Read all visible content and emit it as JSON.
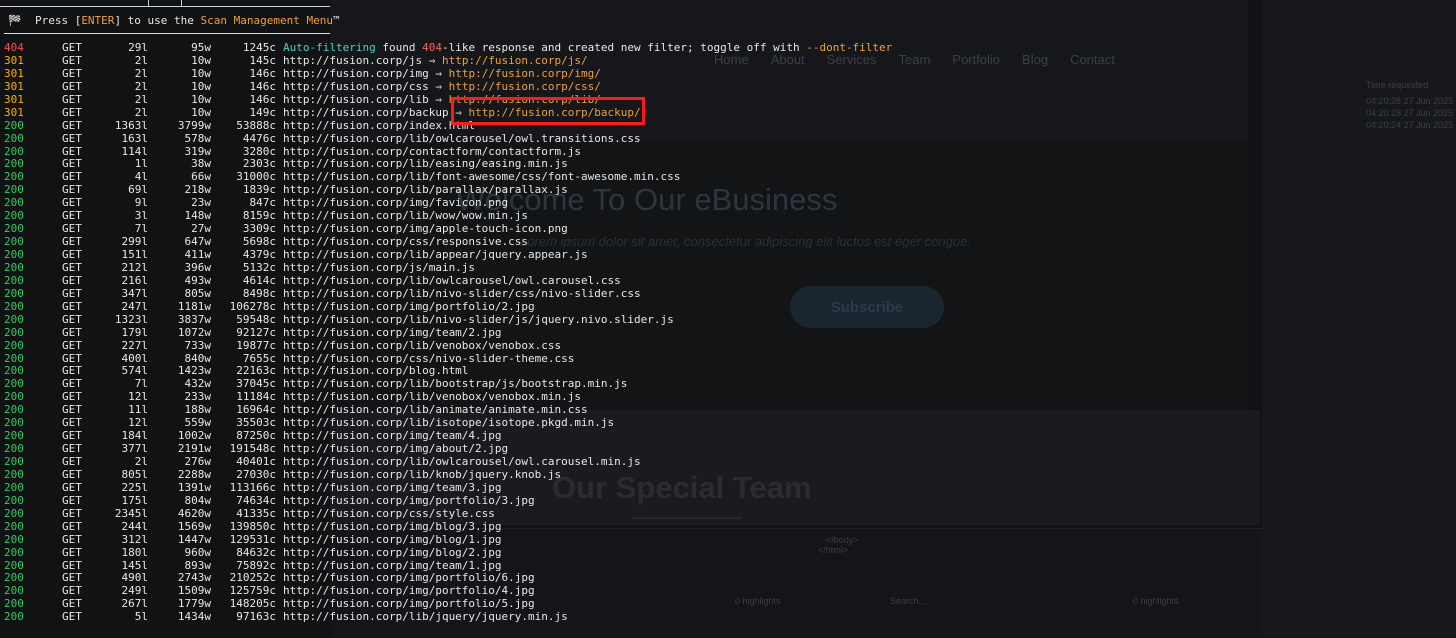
{
  "background": {
    "nav": [
      "Home",
      "About",
      "Services",
      "Team",
      "Portfolio",
      "Blog",
      "Contact"
    ],
    "hero_title": "Welcome To Our eBusiness",
    "hero_subtitle": "Lorem ipsum dolor sit amet, consectetur adipiscing elit luctus est eger congue.",
    "subscribe_label": "Subscribe",
    "team_heading": "Our Special Team",
    "right_panel": {
      "time_header": "Time requested",
      "timestamps": [
        "04:20:28 27 Jun 2025",
        "04:20:28 27 Jun 2025",
        "04:20:24 27 Jun 2025"
      ]
    },
    "devtools": {
      "highlights_left": "0 highlights",
      "highlights_right": "0 highlights",
      "code_lines": [
        "</body>",
        "</html>"
      ],
      "search_placeholder": "Search..."
    }
  },
  "terminal": {
    "press_prefix": "Press [",
    "press_key": "ENTER",
    "press_middle": "] to use the ",
    "press_menu": "Scan Management Menu",
    "press_suffix": "™",
    "flag_icon": "🏁",
    "rows": [
      {
        "status": "404",
        "method": "GET",
        "lines": "29l",
        "words": "95w",
        "chars": "1245c",
        "kind": "auto",
        "url": "",
        "auto_prefix": "Auto-filtering",
        "auto_mid": " found ",
        "auto_404": "404",
        "auto_rest": "-like response and created new filter; toggle off with ",
        "auto_flag": "--dont-filter"
      },
      {
        "status": "301",
        "method": "GET",
        "lines": "2l",
        "words": "10w",
        "chars": "145c",
        "url": "http://fusion.corp/js",
        "redirect": "http://fusion.corp/js/"
      },
      {
        "status": "301",
        "method": "GET",
        "lines": "2l",
        "words": "10w",
        "chars": "146c",
        "url": "http://fusion.corp/img",
        "redirect": "http://fusion.corp/img/"
      },
      {
        "status": "301",
        "method": "GET",
        "lines": "2l",
        "words": "10w",
        "chars": "146c",
        "url": "http://fusion.corp/css",
        "redirect": "http://fusion.corp/css/"
      },
      {
        "status": "301",
        "method": "GET",
        "lines": "2l",
        "words": "10w",
        "chars": "146c",
        "url": "http://fusion.corp/lib",
        "redirect": "http://fusion.corp/lib/"
      },
      {
        "status": "301",
        "method": "GET",
        "lines": "2l",
        "words": "10w",
        "chars": "149c",
        "url": "http://fusion.corp/backup",
        "redirect": "http://fusion.corp/backup/"
      },
      {
        "status": "200",
        "method": "GET",
        "lines": "1363l",
        "words": "3799w",
        "chars": "53888c",
        "url": "http://fusion.corp/index.html"
      },
      {
        "status": "200",
        "method": "GET",
        "lines": "163l",
        "words": "578w",
        "chars": "4476c",
        "url": "http://fusion.corp/lib/owlcarousel/owl.transitions.css"
      },
      {
        "status": "200",
        "method": "GET",
        "lines": "114l",
        "words": "319w",
        "chars": "3280c",
        "url": "http://fusion.corp/contactform/contactform.js"
      },
      {
        "status": "200",
        "method": "GET",
        "lines": "1l",
        "words": "38w",
        "chars": "2303c",
        "url": "http://fusion.corp/lib/easing/easing.min.js"
      },
      {
        "status": "200",
        "method": "GET",
        "lines": "4l",
        "words": "66w",
        "chars": "31000c",
        "url": "http://fusion.corp/lib/font-awesome/css/font-awesome.min.css"
      },
      {
        "status": "200",
        "method": "GET",
        "lines": "69l",
        "words": "218w",
        "chars": "1839c",
        "url": "http://fusion.corp/lib/parallax/parallax.js"
      },
      {
        "status": "200",
        "method": "GET",
        "lines": "9l",
        "words": "23w",
        "chars": "847c",
        "url": "http://fusion.corp/img/favicon.png"
      },
      {
        "status": "200",
        "method": "GET",
        "lines": "3l",
        "words": "148w",
        "chars": "8159c",
        "url": "http://fusion.corp/lib/wow/wow.min.js"
      },
      {
        "status": "200",
        "method": "GET",
        "lines": "7l",
        "words": "27w",
        "chars": "3309c",
        "url": "http://fusion.corp/img/apple-touch-icon.png"
      },
      {
        "status": "200",
        "method": "GET",
        "lines": "299l",
        "words": "647w",
        "chars": "5698c",
        "url": "http://fusion.corp/css/responsive.css"
      },
      {
        "status": "200",
        "method": "GET",
        "lines": "151l",
        "words": "411w",
        "chars": "4379c",
        "url": "http://fusion.corp/lib/appear/jquery.appear.js"
      },
      {
        "status": "200",
        "method": "GET",
        "lines": "212l",
        "words": "396w",
        "chars": "5132c",
        "url": "http://fusion.corp/js/main.js"
      },
      {
        "status": "200",
        "method": "GET",
        "lines": "216l",
        "words": "493w",
        "chars": "4614c",
        "url": "http://fusion.corp/lib/owlcarousel/owl.carousel.css"
      },
      {
        "status": "200",
        "method": "GET",
        "lines": "347l",
        "words": "805w",
        "chars": "8498c",
        "url": "http://fusion.corp/lib/nivo-slider/css/nivo-slider.css"
      },
      {
        "status": "200",
        "method": "GET",
        "lines": "247l",
        "words": "1181w",
        "chars": "106278c",
        "url": "http://fusion.corp/img/portfolio/2.jpg"
      },
      {
        "status": "200",
        "method": "GET",
        "lines": "1323l",
        "words": "3837w",
        "chars": "59548c",
        "url": "http://fusion.corp/lib/nivo-slider/js/jquery.nivo.slider.js"
      },
      {
        "status": "200",
        "method": "GET",
        "lines": "179l",
        "words": "1072w",
        "chars": "92127c",
        "url": "http://fusion.corp/img/team/2.jpg"
      },
      {
        "status": "200",
        "method": "GET",
        "lines": "227l",
        "words": "733w",
        "chars": "19877c",
        "url": "http://fusion.corp/lib/venobox/venobox.css"
      },
      {
        "status": "200",
        "method": "GET",
        "lines": "400l",
        "words": "840w",
        "chars": "7655c",
        "url": "http://fusion.corp/css/nivo-slider-theme.css"
      },
      {
        "status": "200",
        "method": "GET",
        "lines": "574l",
        "words": "1423w",
        "chars": "22163c",
        "url": "http://fusion.corp/blog.html"
      },
      {
        "status": "200",
        "method": "GET",
        "lines": "7l",
        "words": "432w",
        "chars": "37045c",
        "url": "http://fusion.corp/lib/bootstrap/js/bootstrap.min.js"
      },
      {
        "status": "200",
        "method": "GET",
        "lines": "12l",
        "words": "233w",
        "chars": "11184c",
        "url": "http://fusion.corp/lib/venobox/venobox.min.js"
      },
      {
        "status": "200",
        "method": "GET",
        "lines": "11l",
        "words": "188w",
        "chars": "16964c",
        "url": "http://fusion.corp/lib/animate/animate.min.css"
      },
      {
        "status": "200",
        "method": "GET",
        "lines": "12l",
        "words": "559w",
        "chars": "35503c",
        "url": "http://fusion.corp/lib/isotope/isotope.pkgd.min.js"
      },
      {
        "status": "200",
        "method": "GET",
        "lines": "184l",
        "words": "1002w",
        "chars": "87250c",
        "url": "http://fusion.corp/img/team/4.jpg"
      },
      {
        "status": "200",
        "method": "GET",
        "lines": "377l",
        "words": "2191w",
        "chars": "191548c",
        "url": "http://fusion.corp/img/about/2.jpg"
      },
      {
        "status": "200",
        "method": "GET",
        "lines": "2l",
        "words": "276w",
        "chars": "40401c",
        "url": "http://fusion.corp/lib/owlcarousel/owl.carousel.min.js"
      },
      {
        "status": "200",
        "method": "GET",
        "lines": "805l",
        "words": "2288w",
        "chars": "27030c",
        "url": "http://fusion.corp/lib/knob/jquery.knob.js"
      },
      {
        "status": "200",
        "method": "GET",
        "lines": "225l",
        "words": "1391w",
        "chars": "113166c",
        "url": "http://fusion.corp/img/team/3.jpg"
      },
      {
        "status": "200",
        "method": "GET",
        "lines": "175l",
        "words": "804w",
        "chars": "74634c",
        "url": "http://fusion.corp/img/portfolio/3.jpg"
      },
      {
        "status": "200",
        "method": "GET",
        "lines": "2345l",
        "words": "4620w",
        "chars": "41335c",
        "url": "http://fusion.corp/css/style.css"
      },
      {
        "status": "200",
        "method": "GET",
        "lines": "244l",
        "words": "1569w",
        "chars": "139850c",
        "url": "http://fusion.corp/img/blog/3.jpg"
      },
      {
        "status": "200",
        "method": "GET",
        "lines": "312l",
        "words": "1447w",
        "chars": "129531c",
        "url": "http://fusion.corp/img/blog/1.jpg"
      },
      {
        "status": "200",
        "method": "GET",
        "lines": "180l",
        "words": "960w",
        "chars": "84632c",
        "url": "http://fusion.corp/img/blog/2.jpg"
      },
      {
        "status": "200",
        "method": "GET",
        "lines": "145l",
        "words": "893w",
        "chars": "75892c",
        "url": "http://fusion.corp/img/team/1.jpg"
      },
      {
        "status": "200",
        "method": "GET",
        "lines": "490l",
        "words": "2743w",
        "chars": "210252c",
        "url": "http://fusion.corp/img/portfolio/6.jpg"
      },
      {
        "status": "200",
        "method": "GET",
        "lines": "249l",
        "words": "1509w",
        "chars": "125759c",
        "url": "http://fusion.corp/img/portfolio/4.jpg"
      },
      {
        "status": "200",
        "method": "GET",
        "lines": "267l",
        "words": "1779w",
        "chars": "148205c",
        "url": "http://fusion.corp/img/portfolio/5.jpg"
      },
      {
        "status": "200",
        "method": "GET",
        "lines": "5l",
        "words": "1434w",
        "chars": "97163c",
        "url": "http://fusion.corp/lib/jquery/jquery.min.js"
      }
    ]
  },
  "colors": {
    "status_404": "#ff4d4d",
    "status_301": "#ffb000",
    "status_200": "#38c95c",
    "redirect": "#f0a040",
    "highlight_box": "#ff1a1a"
  }
}
